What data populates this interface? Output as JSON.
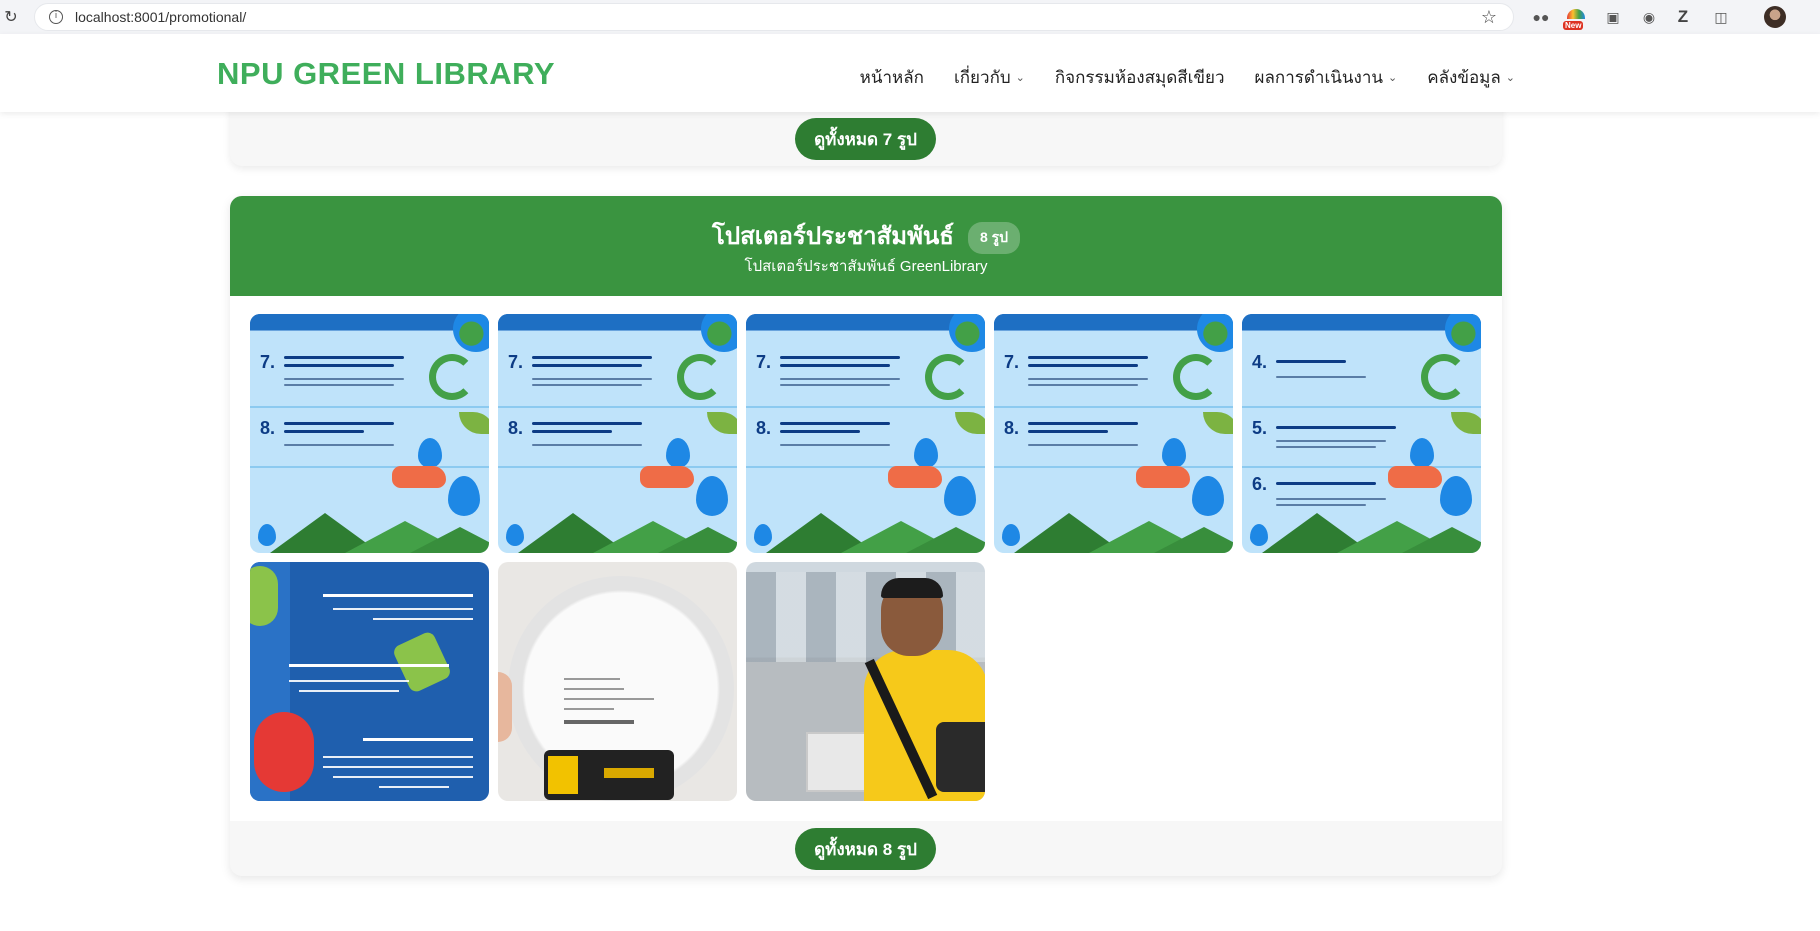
{
  "browser": {
    "url": "localhost:8001/promotional/",
    "ext_new_badge": "New",
    "ext_zotero": "Z"
  },
  "site": {
    "brand": "NPU GREEN LIBRARY",
    "nav": [
      {
        "label": "หน้าหลัก",
        "dropdown": false
      },
      {
        "label": "เกี่ยวกับ",
        "dropdown": true
      },
      {
        "label": "กิจกรรมห้องสมุดสีเขียว",
        "dropdown": false
      },
      {
        "label": "ผลการดำเนินงาน",
        "dropdown": true
      },
      {
        "label": "คลังข้อมูล",
        "dropdown": true
      }
    ]
  },
  "previous_section": {
    "view_all_label": "ดูทั้งหมด 7 รูป"
  },
  "section": {
    "title": "โปสเตอร์ประชาสัมพันธ์",
    "count_badge": "8 รูป",
    "subtitle": "โปสเตอร์ประชาสัมพันธ์ GreenLibrary",
    "view_all_label": "ดูทั้งหมด 8 รูป",
    "thumbnails": [
      {
        "kind": "water-poster",
        "nums": [
          "7.",
          "8."
        ]
      },
      {
        "kind": "water-poster",
        "nums": [
          "7.",
          "8."
        ]
      },
      {
        "kind": "water-poster",
        "nums": [
          "7.",
          "8."
        ]
      },
      {
        "kind": "water-poster",
        "nums": [
          "7.",
          "8."
        ]
      },
      {
        "kind": "water-poster",
        "nums": [
          "4.",
          "5.",
          "6."
        ]
      },
      {
        "kind": "electricity-poster"
      },
      {
        "kind": "photo-smoke-detector"
      },
      {
        "kind": "photo-person"
      }
    ]
  },
  "colors": {
    "brand_green": "#3fae5b",
    "header_green": "#3a9440",
    "button_green": "#2e7d32"
  }
}
